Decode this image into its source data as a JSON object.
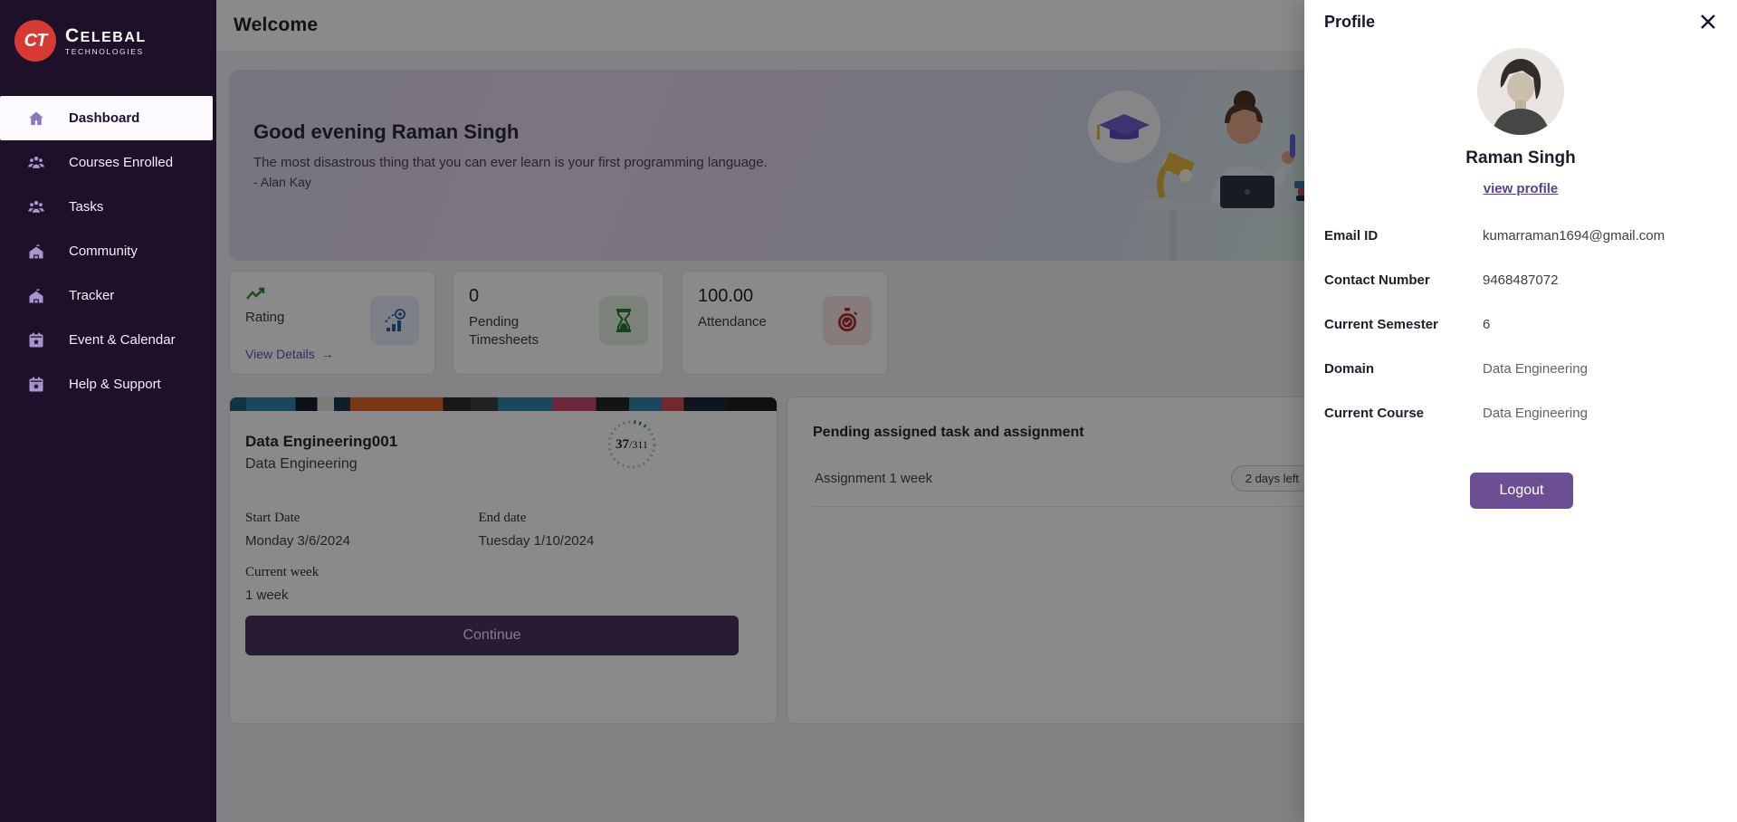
{
  "brand": {
    "initials": "CT",
    "name": "CELEBAL",
    "subname": "TECHNOLOGIES"
  },
  "sidebar": {
    "items": [
      {
        "label": "Dashboard",
        "icon": "home-icon",
        "active": true
      },
      {
        "label": "Courses Enrolled",
        "icon": "users-icon",
        "active": false
      },
      {
        "label": "Tasks",
        "icon": "users-icon",
        "active": false
      },
      {
        "label": "Community",
        "icon": "school-icon",
        "active": false
      },
      {
        "label": "Tracker",
        "icon": "school-icon",
        "active": false
      },
      {
        "label": "Event & Calendar",
        "icon": "calendar-star-icon",
        "active": false
      },
      {
        "label": "Help & Support",
        "icon": "calendar-star-icon",
        "active": false
      }
    ]
  },
  "header": {
    "title": "Welcome"
  },
  "banner": {
    "greeting": "Good evening Raman Singh",
    "quote": "The most disastrous thing that you can ever learn is your first programming language.",
    "author": "- Alan Kay"
  },
  "stats": {
    "rating": {
      "label": "Rating",
      "link": "View Details",
      "arrow": "→",
      "icon": "trend-up-icon",
      "tile_icon": "analytics-icon"
    },
    "timesheets": {
      "value": "0",
      "label": "Pending Timesheets",
      "tile_icon": "hourglass-icon"
    },
    "attendance": {
      "value": "100.00",
      "label": "Attendance",
      "tile_icon": "stopwatch-icon"
    }
  },
  "course": {
    "title": "Data Engineering001",
    "subtitle": "Data Engineering",
    "progress_current": "37",
    "progress_total": "/311",
    "start_date_label": "Start Date",
    "start_date": "Monday 3/6/2024",
    "end_date_label": "End date",
    "end_date": "Tuesday 1/10/2024",
    "current_week_label": "Current week",
    "current_week": "1 week",
    "continue_label": "Continue"
  },
  "pending": {
    "title": "Pending assigned task and assignment",
    "items": [
      {
        "label": "Assignment 1 week",
        "badge": "2 days left"
      }
    ]
  },
  "profile": {
    "title": "Profile",
    "name": "Raman Singh",
    "view_profile": "view profile",
    "fields": [
      {
        "label": "Email ID",
        "value": "kumarraman1694@gmail.com"
      },
      {
        "label": "Contact Number",
        "value": "9468487072"
      },
      {
        "label": "Current Semester",
        "value": "6"
      },
      {
        "label": "Domain",
        "value": "Data Engineering"
      },
      {
        "label": "Current Course",
        "value": "Data Engineering"
      }
    ],
    "logout_label": "Logout"
  },
  "colors": {
    "sidebar_bg": "#1c1129",
    "logo_red": "#d63a32",
    "accent_purple": "#6b4f92",
    "link_purple": "#6d4ea8",
    "continue_purple": "#4a3560",
    "trend_green": "#2e8b3a",
    "hourglass_green": "#2a7a35",
    "stopwatch_red": "#b02a2a",
    "analytics_blue": "#2b5f9e",
    "overlay": "rgba(0,0,0,0.46)"
  }
}
